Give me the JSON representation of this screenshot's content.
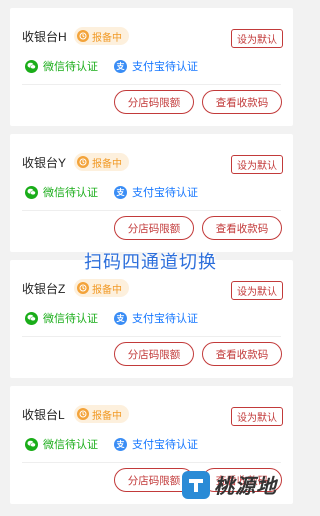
{
  "cashiers": [
    {
      "name": "收银台H",
      "status": "报备中",
      "action": "设为默认",
      "wechat": "微信待认证",
      "alipay": "支付宝待认证",
      "limit_btn": "分店码限额",
      "view_btn": "查看收款码"
    },
    {
      "name": "收银台Y",
      "status": "报备中",
      "action": "设为默认",
      "wechat": "微信待认证",
      "alipay": "支付宝待认证",
      "limit_btn": "分店码限额",
      "view_btn": "查看收款码"
    },
    {
      "name": "收银台Z",
      "status": "报备中",
      "action": "设为默认",
      "wechat": "微信待认证",
      "alipay": "支付宝待认证",
      "limit_btn": "分店码限额",
      "view_btn": "查看收款码"
    },
    {
      "name": "收银台L",
      "status": "报备中",
      "action": "设为默认",
      "wechat": "微信待认证",
      "alipay": "支付宝待认证",
      "limit_btn": "分店码限额",
      "view_btn": "查看收款码"
    }
  ],
  "overlay_text": "扫码四通道切换",
  "watermark": "桃源地",
  "colors": {
    "accent": "#c23a3a",
    "status": "#f19a27",
    "wechat": "#1aad19",
    "alipay": "#1677ff",
    "overlay": "#2d6fdb"
  }
}
